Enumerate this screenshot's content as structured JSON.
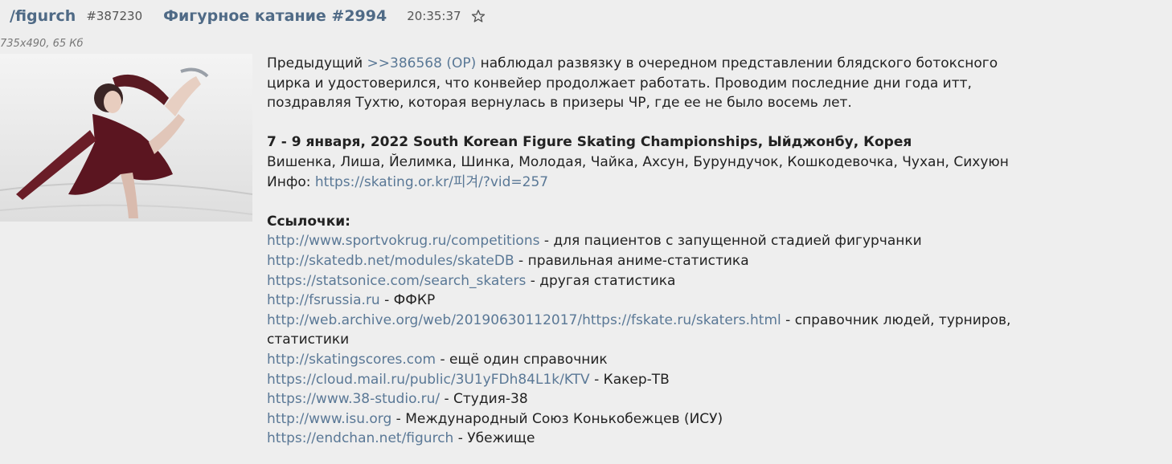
{
  "header": {
    "board": "/figurch",
    "post_number": "#387230",
    "subject": "Фигурное катание #2994",
    "time": "20:35:37",
    "favorite_icon": "star-outline-icon"
  },
  "file": {
    "info": "735x490, 65 Кб",
    "thumbnail_icon": "figure-skater-photo"
  },
  "message": {
    "intro": {
      "prefix": "Предыдущий ",
      "reply_link": ">>386568 (OP)",
      "line1_rest": "  наблюдал развязку в очередном представлении блядского ботоксного",
      "line2": "цирка и удостоверился, что конвейер продолжает работать. Проводим последние дни года итт,",
      "line3": "поздравляя Тухтю, которая вернулась в призеры ЧР, где ее не было восемь лет."
    },
    "event": {
      "title": "7 - 9 января, 2022 South Korean Figure Skating Championships, Ыйджонбу, Корея",
      "skaters": "Вишенка, Лиша, Йелимка, Шинка, Молодая, Чайка, Ахсун, Бурундучок, Кошкодевочка, Чухан, Сихуюн",
      "info_label": "Инфо: ",
      "info_link": "https://skating.or.kr/피겨/?vid=257"
    },
    "links_title": "Ссылочки:",
    "links": [
      {
        "url": "http://www.sportvokrug.ru/competitions",
        "desc": " - для пациентов с запущенной стадией фигурчанки"
      },
      {
        "url": "http://skatedb.net/modules/skateDB",
        "desc": " - правильная аниме-статистика"
      },
      {
        "url": "https://statsonice.com/search_skaters",
        "desc": " - другая статистика"
      },
      {
        "url": "http://fsrussia.ru",
        "desc": " - ФФКР"
      },
      {
        "url": "http://web.archive.org/web/20190630112017/https://fskate.ru/skaters.html",
        "desc": " - справочник людей, турниров,",
        "desc2": "статистики"
      },
      {
        "url": "http://skatingscores.com",
        "desc": " - ещё один справочник"
      },
      {
        "url": "https://cloud.mail.ru/public/3U1yFDh84L1k/KTV",
        "desc": " - Какер-ТВ"
      },
      {
        "url": "https://www.38-studio.ru/",
        "desc": " - Студия-38"
      },
      {
        "url": "http://www.isu.org",
        "desc": " - Международный Союз Конькобежцев (ИСУ)"
      },
      {
        "url": "https://endchan.net/figurch",
        "desc": " - Убежище"
      }
    ]
  }
}
